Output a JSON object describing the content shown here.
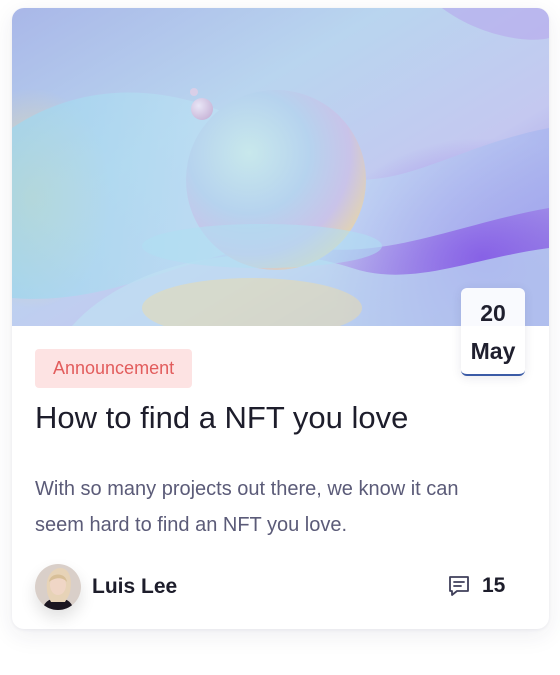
{
  "card": {
    "date": {
      "day": "20",
      "month": "May"
    },
    "tag": "Announcement",
    "title": "How to find a NFT you love",
    "description": "With so many projects out there, we know it can seem hard to find an NFT you love.",
    "author": {
      "name": "Luis Lee",
      "avatar_icon": "avatar-icon"
    },
    "comments": {
      "count": "15",
      "icon": "comment-icon"
    }
  },
  "colors": {
    "tag_bg": "#fde3e3",
    "tag_text": "#e25c5c",
    "title": "#1d1d2b",
    "description": "#5b5b78",
    "date_underline": "#3b5ba6"
  }
}
